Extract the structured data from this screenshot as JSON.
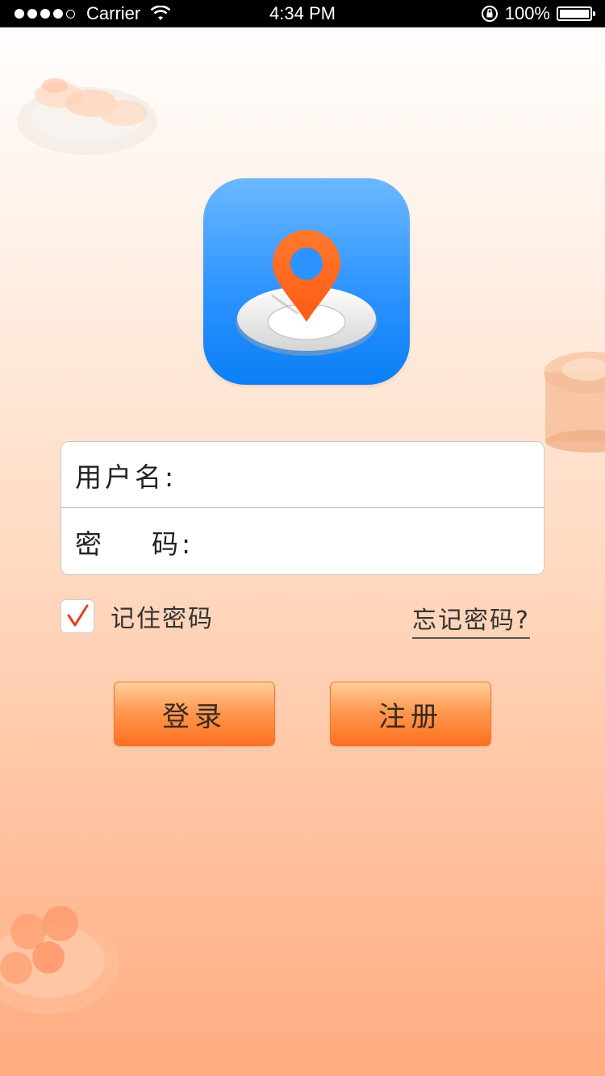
{
  "status_bar": {
    "carrier": "Carrier",
    "time": "4:34 PM",
    "battery": "100%"
  },
  "form": {
    "username_label": "用户名:",
    "password_label": "密    码:"
  },
  "remember": {
    "label": "记住密码",
    "checked": true
  },
  "forgot_label": "忘记密码?",
  "buttons": {
    "login": "登录",
    "register": "注册"
  },
  "colors": {
    "icon_blue": "#2d93ff",
    "pin_orange": "#ff5a14",
    "button_orange": "#ff7a2a",
    "check_red": "#e8401c"
  },
  "icons": {
    "app_icon": "map-pin-on-plate-icon",
    "checkbox_mark": "checkmark-icon"
  }
}
